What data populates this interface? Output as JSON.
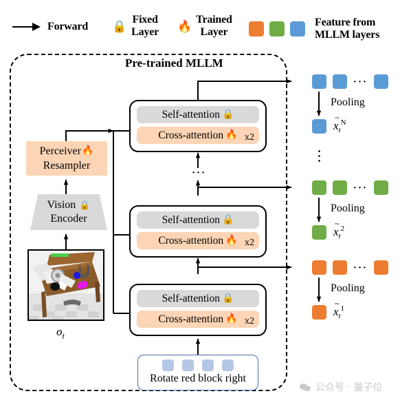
{
  "legend": {
    "forward": {
      "icon": "arrow-right-icon",
      "label": "Forward"
    },
    "fixed": {
      "icon": "lock-icon",
      "glyph": "🔒",
      "line1": "Fixed",
      "line2": "Layer"
    },
    "trained": {
      "icon": "fire-icon",
      "glyph": "🔥",
      "line1": "Trained",
      "line2": "Layer"
    },
    "feature": {
      "line1": "Feature from",
      "line2": "MLLM layers",
      "colors": [
        "#ED7D31",
        "#70AD47",
        "#5B9BD5"
      ]
    }
  },
  "mllm": {
    "title": "Pre-trained MLLM",
    "blocks": [
      {
        "self": "Self-attention",
        "cross": "Cross-attention",
        "repeat": "x2"
      },
      {
        "self": "Self-attention",
        "cross": "Cross-attention",
        "repeat": "x2"
      },
      {
        "self": "Self-attention",
        "cross": "Cross-attention",
        "repeat": "x2"
      }
    ],
    "stack_ellipsis": "···"
  },
  "vision": {
    "perceiver_line1": "Perceiver",
    "perceiver_line2": "Resampler",
    "perceiver_icon": "🔥",
    "encoder_line1": "Vision",
    "encoder_line2": "Encoder",
    "encoder_icon": "🔒",
    "observation_label": "o",
    "observation_sub": "t"
  },
  "prompt": {
    "text": "Rotate red block right",
    "token_count": 4,
    "token_color": "#B4C7E7",
    "border_color": "#4472A8"
  },
  "features": {
    "pooling_label": "Pooling",
    "row_ellipsis": "···",
    "column_ellipsis": "⋮",
    "groups": [
      {
        "color": "#5B9BD5",
        "tokens": 3,
        "pooled_name": "x",
        "pooled_sub": "t",
        "pooled_sup": "N"
      },
      {
        "color": "#70AD47",
        "tokens": 3,
        "pooled_name": "x",
        "pooled_sub": "t",
        "pooled_sup": "2"
      },
      {
        "color": "#ED7D31",
        "tokens": 3,
        "pooled_name": "x",
        "pooled_sub": "t",
        "pooled_sup": "1"
      }
    ]
  },
  "watermark": {
    "text": "公众号 · 量子位"
  }
}
